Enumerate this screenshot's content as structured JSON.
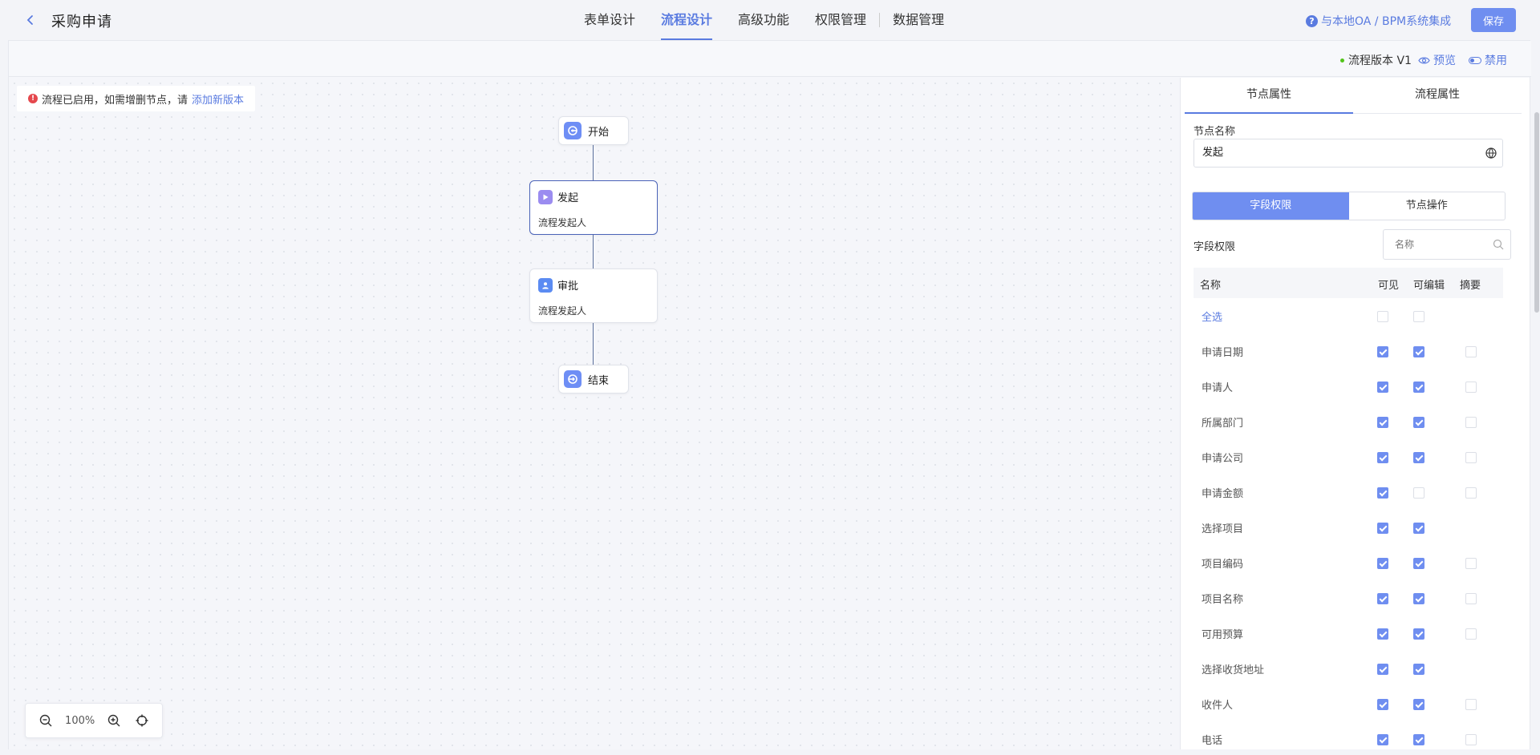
{
  "header": {
    "back_icon": "chevron-left-icon",
    "title": "采购申请",
    "tabs": [
      {
        "label": "表单设计"
      },
      {
        "label": "流程设计"
      },
      {
        "label": "高级功能"
      },
      {
        "label": "权限管理"
      },
      {
        "label": "数据管理"
      }
    ],
    "integration_link": "与本地OA / BPM系统集成",
    "save_label": "保存",
    "accent_color": "#5a7be0"
  },
  "subbar": {
    "version_label": "流程版本 V1",
    "preview_label": "预览",
    "disable_label": "禁用"
  },
  "canvas": {
    "notice_text": "流程已启用，如需增删节点，请",
    "notice_link": "添加新版本",
    "nodes": {
      "start": {
        "label": "开始"
      },
      "initiate": {
        "label": "发起",
        "subtitle": "流程发起人"
      },
      "approve": {
        "label": "审批",
        "subtitle": "流程发起人"
      },
      "end": {
        "label": "结束"
      }
    },
    "zoom_level": "100%"
  },
  "panel": {
    "tabs": [
      {
        "label": "节点属性"
      },
      {
        "label": "流程属性"
      }
    ],
    "node_name_label": "节点名称",
    "node_name_value": "发起",
    "segments": [
      {
        "label": "字段权限"
      },
      {
        "label": "节点操作"
      }
    ],
    "field_perm_label": "字段权限",
    "search_placeholder": "名称",
    "columns": {
      "name": "名称",
      "visible": "可见",
      "editable": "可编辑",
      "summary": "摘要"
    },
    "rows": [
      {
        "name": "全选",
        "visible": false,
        "editable": false,
        "summary": null
      },
      {
        "name": "申请日期",
        "visible": true,
        "editable": true,
        "summary": false
      },
      {
        "name": "申请人",
        "visible": true,
        "editable": true,
        "summary": false
      },
      {
        "name": "所属部门",
        "visible": true,
        "editable": true,
        "summary": false
      },
      {
        "name": "申请公司",
        "visible": true,
        "editable": true,
        "summary": false
      },
      {
        "name": "申请金额",
        "visible": true,
        "editable": false,
        "summary": false
      },
      {
        "name": "选择项目",
        "visible": true,
        "editable": true,
        "summary": null
      },
      {
        "name": "项目编码",
        "visible": true,
        "editable": true,
        "summary": false
      },
      {
        "name": "项目名称",
        "visible": true,
        "editable": true,
        "summary": false
      },
      {
        "name": "可用预算",
        "visible": true,
        "editable": true,
        "summary": false
      },
      {
        "name": "选择收货地址",
        "visible": true,
        "editable": true,
        "summary": null
      },
      {
        "name": "收件人",
        "visible": true,
        "editable": true,
        "summary": false
      },
      {
        "name": "电话",
        "visible": true,
        "editable": true,
        "summary": false
      }
    ]
  }
}
